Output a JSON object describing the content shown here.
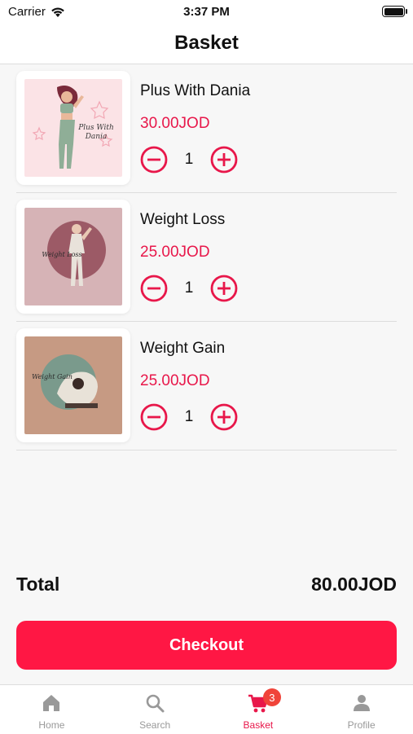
{
  "status_bar": {
    "carrier": "Carrier",
    "time": "3:37 PM",
    "battery_level": 1.0
  },
  "header": {
    "title": "Basket"
  },
  "items": [
    {
      "name": "Plus With Dania",
      "price": "30.00JOD",
      "quantity": "1",
      "image_caption": "Plus With Dania"
    },
    {
      "name": "Weight Loss",
      "price": "25.00JOD",
      "quantity": "1",
      "image_caption": "Weight Loss"
    },
    {
      "name": "Weight Gain",
      "price": "25.00JOD",
      "quantity": "1",
      "image_caption": "Weight Gain"
    }
  ],
  "total": {
    "label": "Total",
    "value": "80.00JOD"
  },
  "checkout": {
    "label": "Checkout"
  },
  "tabs": [
    {
      "label": "Home",
      "icon": "home-icon"
    },
    {
      "label": "Search",
      "icon": "search-icon"
    },
    {
      "label": "Basket",
      "icon": "cart-icon",
      "badge": "3",
      "active": true
    },
    {
      "label": "Profile",
      "icon": "profile-icon"
    }
  ],
  "colors": {
    "accent": "#e8174a",
    "button": "#ff1744",
    "badge": "#f0443a"
  }
}
